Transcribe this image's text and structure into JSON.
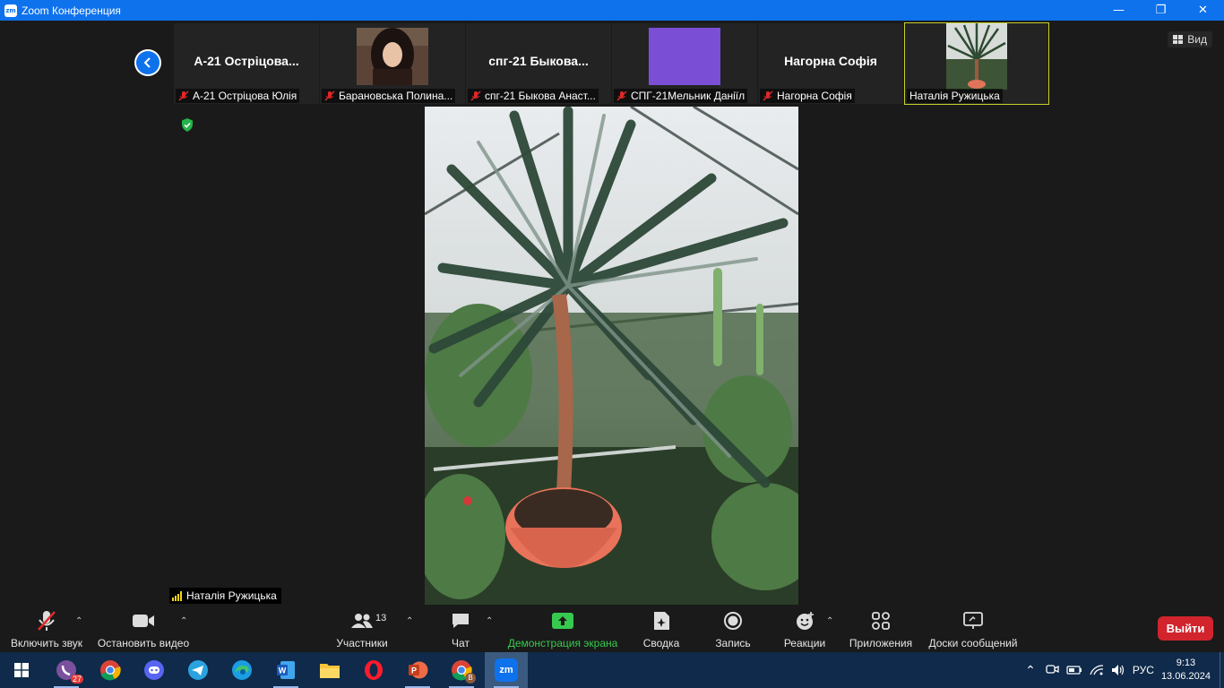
{
  "window": {
    "title": "Zoom Конференция",
    "logo_text": "zm",
    "controls": {
      "minimize": "—",
      "restore": "❐",
      "close": "✕"
    }
  },
  "view_button": {
    "label": "Вид"
  },
  "participants_strip": [
    {
      "display_name": "А-21 Острiцова...",
      "label": "А-21 Острiцова Юлiя",
      "muted": true,
      "type": "name"
    },
    {
      "display_name": "",
      "label": "Барановська Полина...",
      "muted": true,
      "type": "photo"
    },
    {
      "display_name": "спг-21 Быкова...",
      "label": "спг-21 Быкова Анаст...",
      "muted": true,
      "type": "name"
    },
    {
      "display_name": "",
      "label": "СПГ-21Мельник Даніїл",
      "muted": true,
      "type": "color",
      "color": "#7a4fd6"
    },
    {
      "display_name": "Нагорна Софiя",
      "label": "Нагорна Софiя",
      "muted": true,
      "type": "name"
    },
    {
      "display_name": "",
      "label": "Наталiя Ружицька",
      "muted": false,
      "type": "plant",
      "active": true
    }
  ],
  "active_speaker": {
    "label": "Наталiя Ружицька"
  },
  "toolbar": {
    "mute": {
      "label": "Включить звук"
    },
    "video": {
      "label": "Остановить видео"
    },
    "participants": {
      "label": "Участники",
      "count": "13"
    },
    "chat": {
      "label": "Чат"
    },
    "share": {
      "label": "Демонстрация экрана"
    },
    "summary": {
      "label": "Сводка"
    },
    "record": {
      "label": "Запись"
    },
    "reactions": {
      "label": "Реакции"
    },
    "apps": {
      "label": "Приложения"
    },
    "whiteboards": {
      "label": "Доски сообщений"
    },
    "leave": {
      "label": "Выйти"
    }
  },
  "taskbar": {
    "viber_badge": "27",
    "chrome_profile_badge": "B",
    "zoom_label": "zm",
    "language": "РУС",
    "time": "9:13",
    "date": "13.06.2024"
  },
  "colors": {
    "zoom_blue": "#0e72ed",
    "leave_red": "#d1242c",
    "share_green": "#37c94f",
    "active_border": "#c8d12c"
  }
}
